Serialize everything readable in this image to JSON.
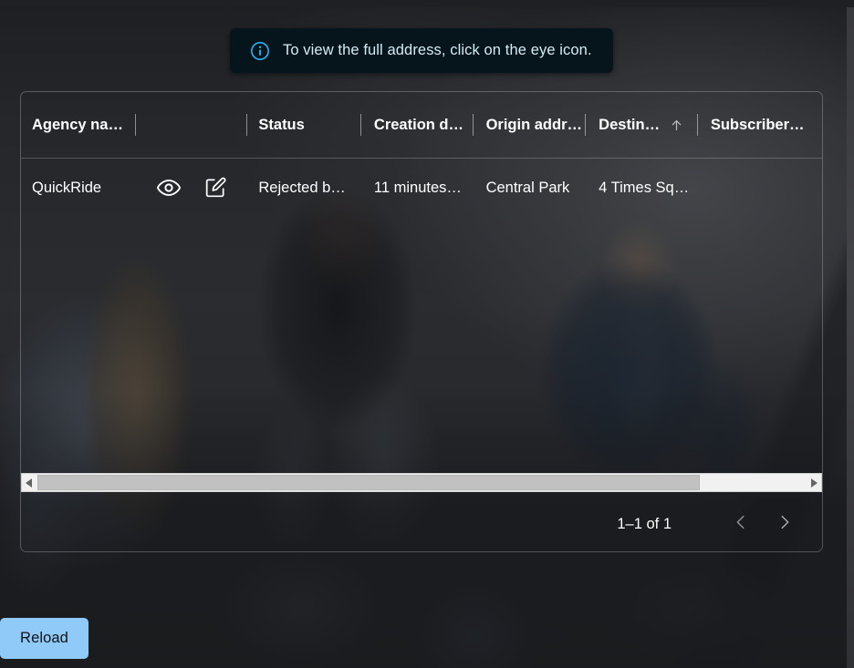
{
  "toast": {
    "icon": "info-circle-icon",
    "message": "To view the full address, click on the eye icon.",
    "background_color": "#06141b",
    "accent_color": "#29b6f6"
  },
  "table": {
    "columns": [
      {
        "label": "Agency na…",
        "key": "agency_name",
        "sorted": false
      },
      {
        "label": "",
        "key": "actions",
        "sorted": false
      },
      {
        "label": "Status",
        "key": "status",
        "sorted": false
      },
      {
        "label": "Creation d…",
        "key": "creation_date",
        "sorted": false
      },
      {
        "label": "Origin addr…",
        "key": "origin_address",
        "sorted": false
      },
      {
        "label": "Destin…",
        "key": "destination_address",
        "sorted": true,
        "sort_direction": "ascending",
        "sort_icon": "arrow-up-icon"
      },
      {
        "label": "Subscriber…",
        "key": "subscriber",
        "sorted": false
      }
    ],
    "rows": [
      {
        "agency_name": "QuickRide",
        "actions": [
          {
            "name": "view-address-icon",
            "icon": "eye-icon"
          },
          {
            "name": "edit-row-icon",
            "icon": "edit-pencil-box-icon"
          }
        ],
        "status": "Rejected b…",
        "creation_date": "11 minutes…",
        "origin_address": "Central Park",
        "destination_address": "4 Times Sq…",
        "subscriber": ""
      }
    ]
  },
  "scrollbar": {
    "orientation": "horizontal",
    "left_arrow_icon": "triangle-left-icon",
    "right_arrow_icon": "triangle-right-icon",
    "thumb_fraction": "86%"
  },
  "paginator": {
    "range_label": "1–1 of 1",
    "previous_icon": "chevron-left-icon",
    "next_icon": "chevron-right-icon",
    "previous_enabled": false,
    "next_enabled": false
  },
  "actions": {
    "reload_label": "Reload",
    "reload_color": "#90caf9"
  }
}
